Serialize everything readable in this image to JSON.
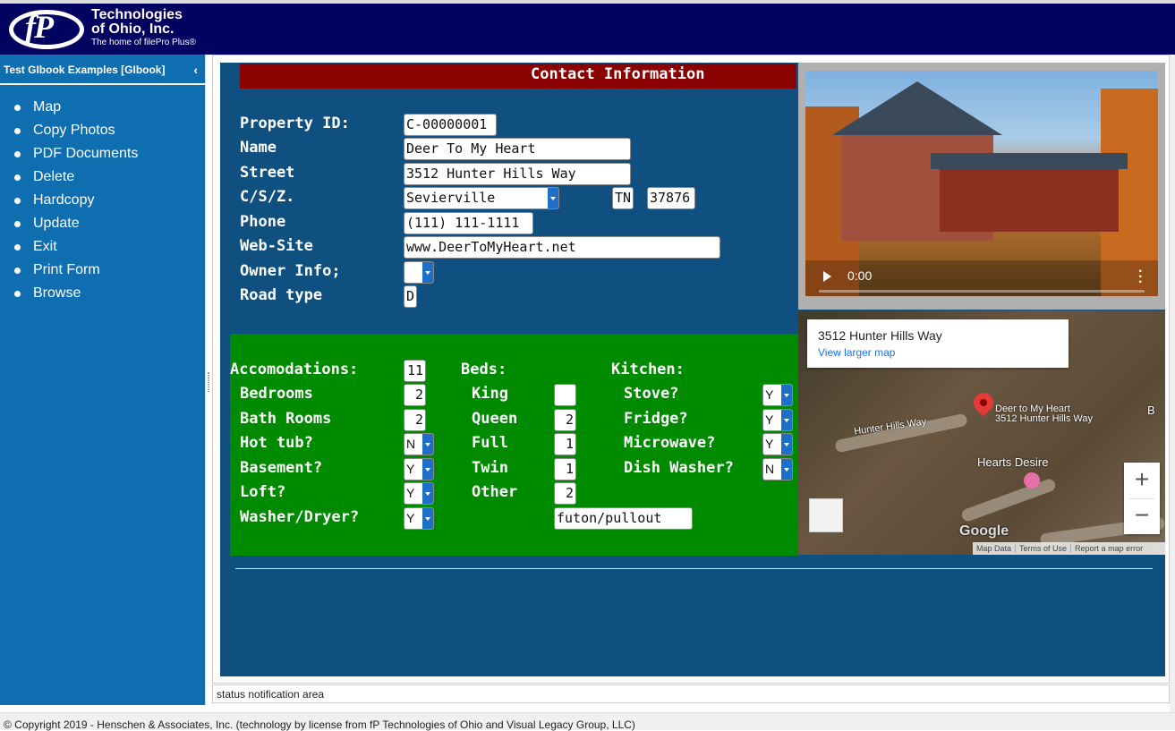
{
  "header": {
    "logo_mark": "fP",
    "logo_line1": "Technologies",
    "logo_line2": "of Ohio, Inc.",
    "tagline": "The home of filePro Plus®"
  },
  "sidebar": {
    "title": "Test GIbook Examples [GIbook]",
    "collapse_glyph": "‹",
    "items": [
      {
        "label": "Map"
      },
      {
        "label": "Copy Photos"
      },
      {
        "label": "PDF Documents"
      },
      {
        "label": "Delete"
      },
      {
        "label": "Hardcopy"
      },
      {
        "label": "Update"
      },
      {
        "label": "Exit"
      },
      {
        "label": "Print Form"
      },
      {
        "label": "Browse"
      }
    ]
  },
  "form": {
    "title": "Contact Information",
    "labels": {
      "property_id": "Property ID:",
      "name": "Name",
      "street": "Street",
      "csz": "C/S/Z.",
      "phone": "Phone",
      "website": "Web-Site",
      "owner_info": "Owner Info;",
      "road_type": "Road type"
    },
    "values": {
      "property_id": "C-00000001",
      "name": "Deer To My Heart",
      "street": "3512 Hunter Hills Way",
      "city": "Sevierville",
      "state": "TN",
      "zip": "37876",
      "phone": "(111) 111-1111",
      "website": "www.DeerToMyHeart.net",
      "owner_info": "",
      "road_type": "D"
    }
  },
  "amenities": {
    "accommodations_label": "Accomodations:",
    "accommodations_value": "11",
    "beds_label": "Beds:",
    "kitchen_label": "Kitchen:",
    "rooms": [
      {
        "label": "Bedrooms",
        "value": "2"
      },
      {
        "label": "Bath Rooms",
        "value": "2"
      },
      {
        "label": "Hot tub?",
        "value": "N"
      },
      {
        "label": "Basement?",
        "value": "Y"
      },
      {
        "label": "Loft?",
        "value": "Y"
      },
      {
        "label": "Washer/Dryer?",
        "value": "Y"
      }
    ],
    "beds": [
      {
        "label": "King",
        "value": ""
      },
      {
        "label": "Queen",
        "value": "2"
      },
      {
        "label": "Full",
        "value": "1"
      },
      {
        "label": "Twin",
        "value": "1"
      },
      {
        "label": "Other",
        "value": "2"
      }
    ],
    "other_note": "futon/pullout",
    "kitchen": [
      {
        "label": "Stove?",
        "value": "Y"
      },
      {
        "label": "Fridge?",
        "value": "Y"
      },
      {
        "label": "Microwave?",
        "value": "Y"
      },
      {
        "label": "Dish Washer?",
        "value": "N"
      }
    ]
  },
  "video": {
    "time": "0:00"
  },
  "map": {
    "card_title": "3512 Hunter Hills Way",
    "card_link": "View larger map",
    "pin_label_1": "Deer to My Heart",
    "pin_label_2": "3512 Hunter Hills Way",
    "road_label": "Hunter Hills Way",
    "poi_label": "Hearts Desire",
    "edge_label": "B",
    "google": "Google",
    "attrib": [
      "Map Data",
      "Terms of Use",
      "Report a map error"
    ],
    "zoom_in": "+",
    "zoom_out": "−"
  },
  "status": "status notification area",
  "footer": "© Copyright 2019 - Henschen & Associates, Inc. (technology by license from fP Technologies of Ohio and Visual Legacy Group, LLC)"
}
